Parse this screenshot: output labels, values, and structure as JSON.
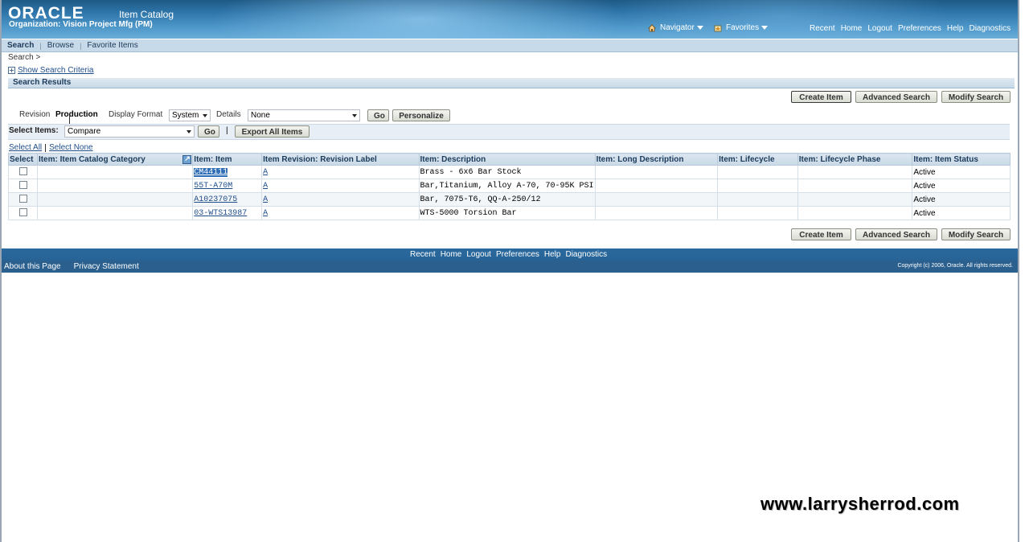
{
  "header": {
    "logo": "ORACLE",
    "app_title": "Item Catalog",
    "organization": "Organization: Vision Project Mfg (PM)",
    "navigator_label": "Navigator",
    "favorites_label": "Favorites",
    "global_links": [
      "Recent",
      "Home",
      "Logout",
      "Preferences",
      "Help",
      "Diagnostics"
    ]
  },
  "tabs": {
    "search": "Search",
    "browse": "Browse",
    "favorite_items": "Favorite Items"
  },
  "breadcrumb": "Search  >",
  "show_search_criteria": "Show Search Criteria",
  "section_title": "Search Results",
  "buttons": {
    "create_item": "Create Item",
    "advanced_search": "Advanced Search",
    "modify_search": "Modify Search",
    "go": "Go",
    "personalize": "Personalize",
    "export_all": "Export All Items"
  },
  "controls": {
    "revision_label": "Revision",
    "revision_value": "Production",
    "display_format_label": "Display Format",
    "display_format_value": "System",
    "details_label": "Details",
    "details_value": "None",
    "select_items_label": "Select Items:",
    "select_items_value": "Compare",
    "divider": "|"
  },
  "select_all": "Select All",
  "select_none": "Select None",
  "table": {
    "headers": [
      "Select",
      "Item: Item Catalog Category",
      "Item: Item",
      "Item Revision: Revision Label",
      "Item: Description",
      "Item: Long Description",
      "Item: Lifecycle",
      "Item: Lifecycle Phase",
      "Item: Item Status"
    ],
    "rows": [
      {
        "item": "CM44111",
        "revision": "A",
        "description": "Brass - 6x6 Bar Stock",
        "status": "Active"
      },
      {
        "item": "55T-A70M",
        "revision": "A",
        "description": "Bar,Titanium, Alloy A-70, 70-95K PSI",
        "status": "Active"
      },
      {
        "item": "A10237075",
        "revision": "A",
        "description": "Bar, 7075-T6, QQ-A-250/12",
        "status": "Active"
      },
      {
        "item": "03-WTS13987",
        "revision": "A",
        "description": "WTS-5000 Torsion Bar",
        "status": "Active"
      }
    ]
  },
  "footer": {
    "links": [
      "Recent",
      "Home",
      "Logout",
      "Preferences",
      "Help",
      "Diagnostics"
    ],
    "about": "About this Page",
    "privacy": "Privacy Statement",
    "copyright": "Copyright (c) 2006, Oracle. All rights reserved."
  },
  "watermark": "www.larrysherrod.com"
}
